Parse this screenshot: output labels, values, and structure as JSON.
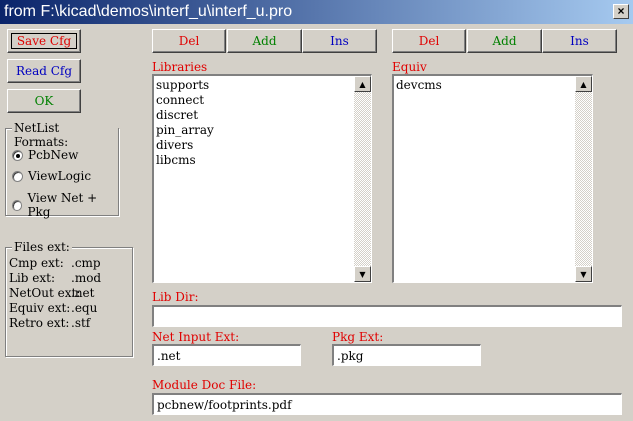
{
  "window": {
    "title": "from F:\\kicad\\demos\\interf_u\\interf_u.pro",
    "close_label": "×"
  },
  "left_buttons": {
    "save_cfg": "Save Cfg",
    "read_cfg": "Read Cfg",
    "ok": "OK"
  },
  "netlist_formats": {
    "title": "NetList Formats:",
    "options": [
      {
        "label": "PcbNew",
        "selected": true
      },
      {
        "label": "ViewLogic",
        "selected": false
      },
      {
        "label": "View Net + Pkg",
        "selected": false
      }
    ]
  },
  "files_ext": {
    "title": "Files ext:",
    "rows": [
      {
        "name": "Cmp ext:",
        "value": ".cmp"
      },
      {
        "name": "Lib ext:",
        "value": ".mod"
      },
      {
        "name": "NetOut ext:",
        "value": ".net"
      },
      {
        "name": "Equiv ext:",
        "value": ".equ"
      },
      {
        "name": "Retro ext:",
        "value": ".stf"
      }
    ]
  },
  "libraries": {
    "buttons": {
      "del": "Del",
      "add": "Add",
      "ins": "Ins"
    },
    "label": "Libraries",
    "items": [
      "supports",
      "connect",
      "discret",
      "pin_array",
      "divers",
      "libcms"
    ]
  },
  "equiv": {
    "buttons": {
      "del": "Del",
      "add": "Add",
      "ins": "Ins"
    },
    "label": "Equiv",
    "items": [
      "devcms"
    ]
  },
  "lib_dir": {
    "label": "Lib Dir:",
    "value": ""
  },
  "net_input_ext": {
    "label": "Net Input Ext:",
    "value": ".net"
  },
  "pkg_ext": {
    "label": "Pkg Ext:",
    "value": ".pkg"
  },
  "module_doc_file": {
    "label": "Module Doc File:",
    "value": "pcbnew/footprints.pdf"
  },
  "colors": {
    "title_start": "#0a246a",
    "title_end": "#a6caf0",
    "red": "#e00000",
    "green": "#008000",
    "blue": "#0000c0",
    "face": "#d4d0c8"
  }
}
